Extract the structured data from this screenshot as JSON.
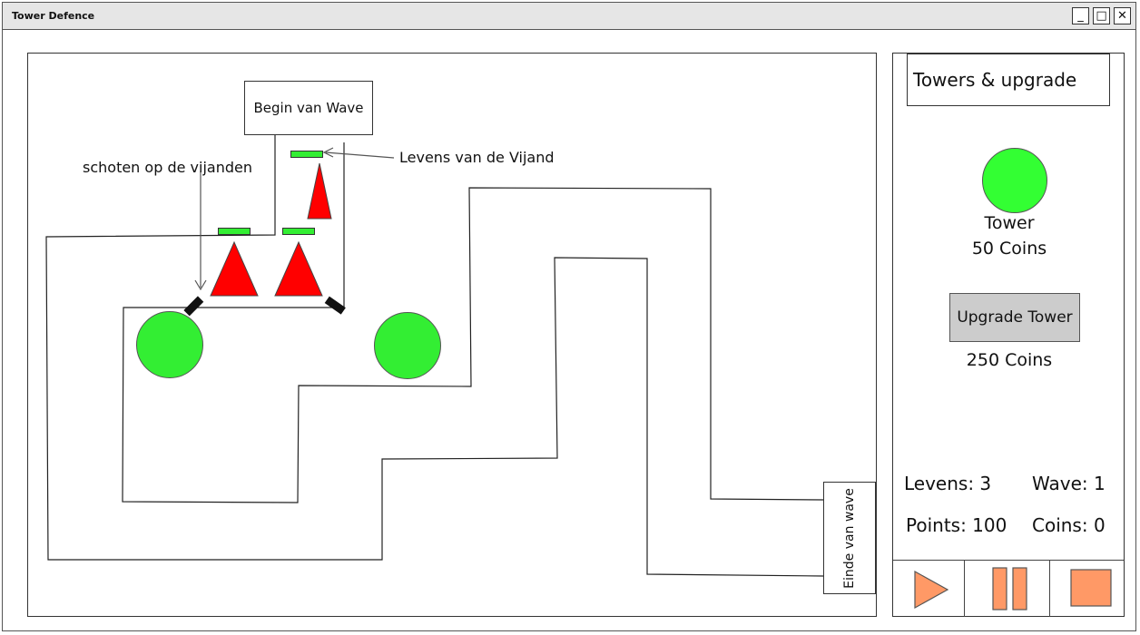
{
  "window": {
    "title": "Tower Defence"
  },
  "map": {
    "start_label": "Begin van Wave",
    "end_label": "Einde van wave",
    "annotation_shots": "schoten op de vijanden",
    "annotation_health": "Levens van de Vijand"
  },
  "panel": {
    "title": "Towers & upgrade",
    "tower_label": "Tower",
    "tower_cost": "50 Coins",
    "upgrade_label": "Upgrade Tower",
    "upgrade_cost": "250 Coins",
    "lives": "Levens: 3",
    "wave": "Wave: 1",
    "points": "Points: 100",
    "coins": "Coins: 0"
  },
  "colors": {
    "tower": "#33ff33",
    "enemy": "#ff0000",
    "control": "#ff9966",
    "button": "#cccccc"
  },
  "icons": [
    "play-icon",
    "pause-icon",
    "stop-icon",
    "minimize-icon",
    "maximize-icon",
    "close-icon"
  ]
}
